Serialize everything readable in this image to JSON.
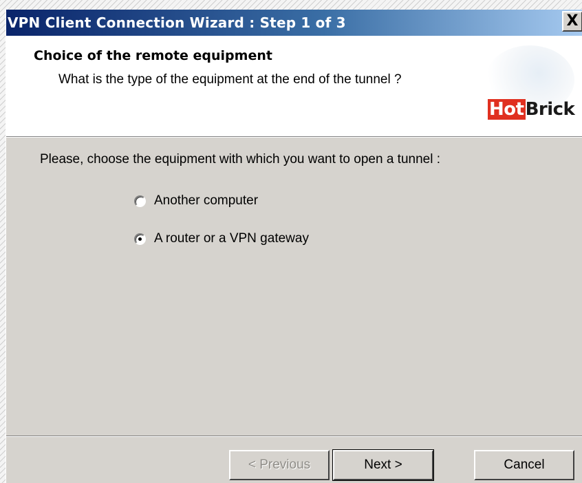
{
  "window": {
    "title": "VPN Client Connection Wizard : Step 1 of 3",
    "close_label": "X"
  },
  "header": {
    "title": "Choice of the remote equipment",
    "subtitle": "What is the type of the equipment at the end of the tunnel ?",
    "logo": {
      "part1": "Hot",
      "part2": "Brick"
    }
  },
  "body": {
    "prompt": "Please, choose the equipment with which you want to open a tunnel :",
    "options": [
      {
        "label": "Another computer",
        "checked": false
      },
      {
        "label": "A router or a VPN gateway",
        "checked": true
      }
    ]
  },
  "buttons": {
    "previous": "< Previous",
    "next": "Next >",
    "cancel": "Cancel"
  }
}
